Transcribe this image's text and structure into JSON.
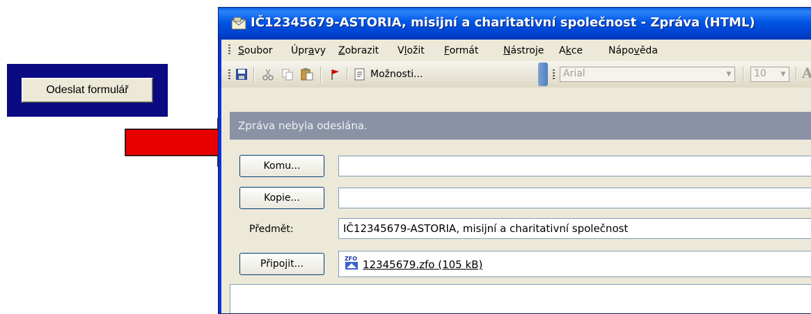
{
  "submit_panel": {
    "button_label": "Odeslat formulář"
  },
  "window": {
    "title": "IČ12345679-ASTORIA, misijní a charitativní společnost - Zpráva (HTML)"
  },
  "menu": {
    "items": [
      {
        "pre": "",
        "accel": "S",
        "post": "oubor"
      },
      {
        "pre": "Úpr",
        "accel": "a",
        "post": "vy"
      },
      {
        "pre": "",
        "accel": "Z",
        "post": "obrazit"
      },
      {
        "pre": "V",
        "accel": "l",
        "post": "ožit"
      },
      {
        "pre": "",
        "accel": "F",
        "post": "ormát"
      },
      {
        "pre": "",
        "accel": "N",
        "post": "ástroje"
      },
      {
        "pre": "A",
        "accel": "k",
        "post": "ce"
      },
      {
        "pre": "Nápo",
        "accel": "v",
        "post": "ěda"
      }
    ]
  },
  "toolbar": {
    "options_label": "Možnosti...",
    "icons": [
      "save-icon",
      "cut-icon",
      "copy-icon",
      "paste-icon",
      "flag-icon",
      "options-icon"
    ],
    "font_value": "Arial",
    "size_value": "10",
    "bold_glyph": "A"
  },
  "info_bar": {
    "text": "Zpráva nebyla odeslána."
  },
  "form": {
    "to_button": "Komu...",
    "cc_button": "Kopie...",
    "subject_label": "Předmět:",
    "subject_value": "IČ12345679-ASTORIA, misijní a charitativní společnost",
    "attach_button": "Připojit...",
    "attachment": "12345679.zfo (105 kB)"
  },
  "colors": {
    "frame_blue": "#0a0a82",
    "arrow_red": "#e80000",
    "title_blue": "#0055e5",
    "info_bar": "#8a92a6"
  }
}
